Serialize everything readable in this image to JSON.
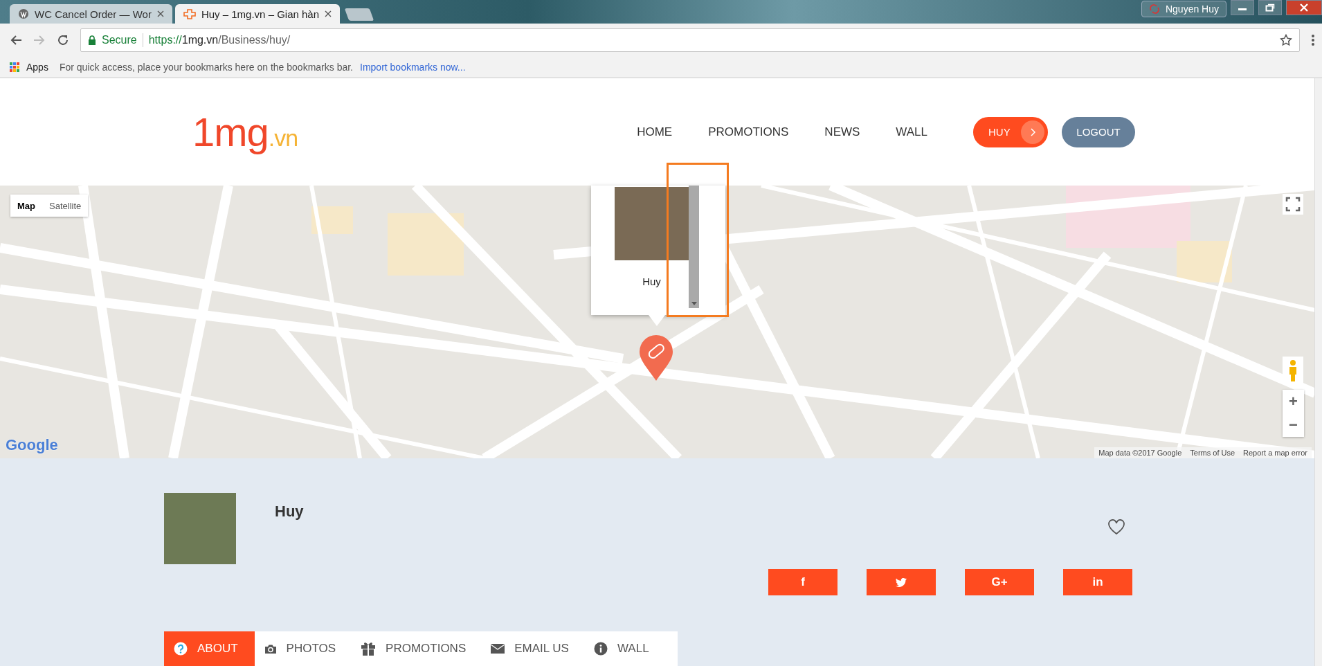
{
  "browser": {
    "tabs": [
      {
        "title": "WC Cancel Order — Wor",
        "kind": "wordpress",
        "selected": false
      },
      {
        "title": "Huy – 1mg.vn – Gian hàn",
        "kind": "site",
        "selected": true
      }
    ],
    "profile": "Nguyen Huy",
    "address": {
      "secure": "Secure",
      "scheme": "https://",
      "host": "1mg.vn",
      "path": "/Business/huy/"
    },
    "bookmarks": {
      "apps": "Apps",
      "hint": "For quick access, place your bookmarks here on the bookmarks bar.",
      "link": "Import bookmarks now..."
    }
  },
  "site": {
    "logo": {
      "main": "1mg",
      "suffix": ".vn"
    },
    "nav": [
      {
        "label": "HOME"
      },
      {
        "label": "PROMOTIONS"
      },
      {
        "label": "NEWS"
      },
      {
        "label": "WALL"
      }
    ],
    "user_button": "HUY",
    "logout_button": "LOGOUT"
  },
  "map": {
    "types": [
      {
        "label": "Map",
        "selected": true
      },
      {
        "label": "Satellite",
        "selected": false
      }
    ],
    "popup": {
      "title": "Huy"
    },
    "google_logo": "Google",
    "zoom_in": "+",
    "zoom_out": "−",
    "attribution": [
      "Map data ©2017 Google",
      "Terms of Use",
      "Report a map error"
    ]
  },
  "profile": {
    "name": "Huy",
    "social": [
      {
        "kind": "facebook",
        "glyph": "f"
      },
      {
        "kind": "twitter"
      },
      {
        "kind": "google-plus",
        "glyph": "G+"
      },
      {
        "kind": "linkedin",
        "glyph": "in"
      }
    ]
  },
  "tabs": [
    {
      "label": "ABOUT",
      "kind": "question",
      "selected": true
    },
    {
      "label": "PHOTOS",
      "kind": "camera",
      "selected": false
    },
    {
      "label": "PROMOTIONS",
      "kind": "gift",
      "selected": false
    },
    {
      "label": "EMAIL US",
      "kind": "mail",
      "selected": false
    },
    {
      "label": "WALL",
      "kind": "info",
      "selected": false
    }
  ]
}
